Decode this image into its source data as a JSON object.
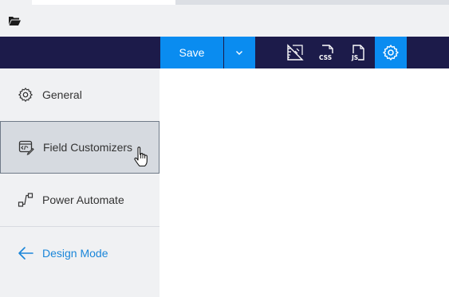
{
  "toolbar": {
    "save_label": "Save",
    "icons": [
      "ruler-icon",
      "css-file-icon",
      "js-file-icon",
      "gear-icon"
    ],
    "accent_color": "#0a8cf0",
    "bar_color": "#1c1b4a"
  },
  "sidebar": {
    "items": [
      {
        "label": "General",
        "icon": "gear-icon"
      },
      {
        "label": "Field Customizers",
        "icon": "code-edit-icon",
        "selected": true
      },
      {
        "label": "Power Automate",
        "icon": "flow-icon"
      },
      {
        "label": "Design Mode",
        "icon": "arrow-left-icon",
        "color": "#1a86d9"
      }
    ]
  }
}
